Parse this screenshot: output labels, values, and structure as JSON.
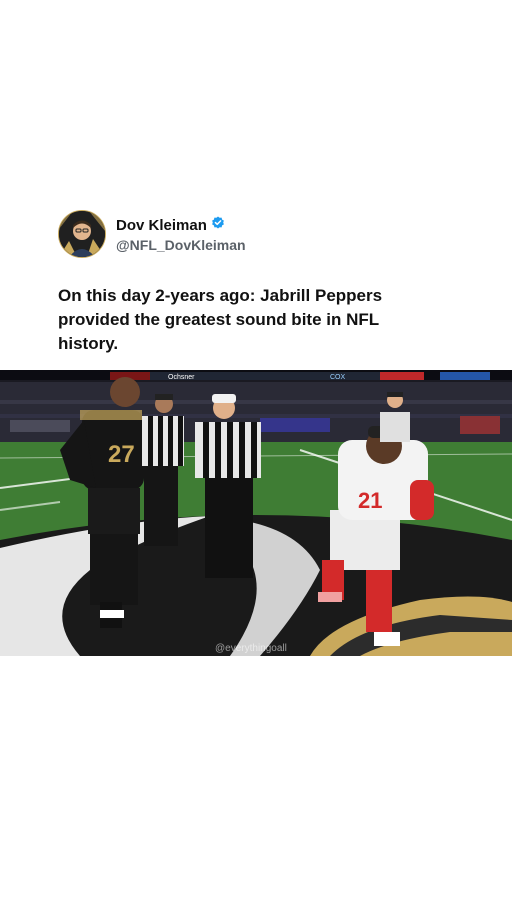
{
  "author": {
    "display_name": "Dov Kleiman",
    "handle": "@NFL_DovKleiman",
    "verified": true,
    "avatar_icon": "person-avatar-icon",
    "verified_icon": "verified-badge-icon"
  },
  "tweet": {
    "text_line1": "On this day 2-years ago: Jabrill Peppers",
    "text_line2": "provided the greatest sound bite in NFL",
    "text_line3": "history."
  },
  "media": {
    "type": "video-still",
    "jersey_left": "27",
    "jersey_right": "21",
    "watermark": "@everythingoall",
    "scoreboard_brand": "Ochsner",
    "scoreboard_sponsor": "COX",
    "colors": {
      "field_green": "#3f7d34",
      "saints_black": "#151515",
      "saints_gold": "#c9a95c",
      "giants_red": "#d32a2a",
      "verified_blue": "#1d9bf0"
    }
  }
}
